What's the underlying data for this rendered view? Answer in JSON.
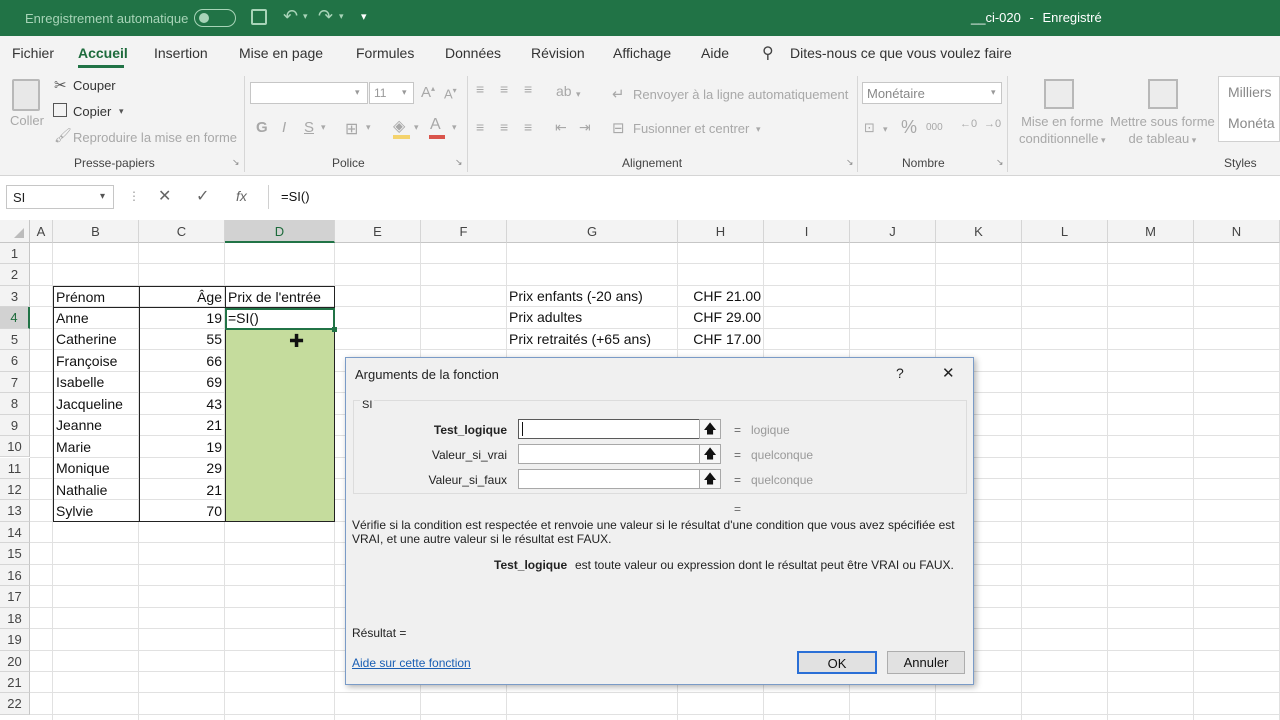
{
  "titlebar": {
    "autosave_label": "Enregistrement automatique",
    "filename": "__ci-020",
    "separator": "-",
    "status": "Enregistré",
    "save_icon": "save-icon",
    "undo_icon": "undo-icon",
    "redo_icon": "redo-icon",
    "bg_color": "#217346"
  },
  "ribbon_tabs": [
    "Fichier",
    "Accueil",
    "Insertion",
    "Mise en page",
    "Formules",
    "Données",
    "Révision",
    "Affichage",
    "Aide"
  ],
  "tell_me": "Dites-nous ce que vous voulez faire",
  "clipboard": {
    "paste": "Coller",
    "cut": "Couper",
    "copy": "Copier",
    "format_painter": "Reproduire la mise en forme",
    "group": "Presse-papiers"
  },
  "font": {
    "name_value": "",
    "size_value": "11",
    "bold": "G",
    "italic": "I",
    "underline": "S",
    "group": "Police"
  },
  "alignment": {
    "wrap_text": "Renvoyer à la ligne automatiquement",
    "merge_center": "Fusionner et centrer",
    "group": "Alignement"
  },
  "number": {
    "format_value": "Monétaire",
    "percent": "%",
    "thousands": "000",
    "group": "Nombre"
  },
  "styles": {
    "conditional": [
      "Mise en forme",
      "conditionnelle"
    ],
    "table_format": [
      "Mettre sous forme",
      "de tableau"
    ],
    "cell_style_1": "Milliers",
    "cell_style_2": "Monéta",
    "group": "Styles"
  },
  "formula_bar": {
    "name_box": "SI",
    "cancel_icon": "✕",
    "enter_icon": "✓",
    "fx": "fx",
    "formula": "=SI()"
  },
  "columns": [
    "A",
    "B",
    "C",
    "D",
    "E",
    "F",
    "G",
    "H",
    "I",
    "J",
    "K",
    "L",
    "M",
    "N"
  ],
  "rows": [
    "1",
    "2",
    "3",
    "4",
    "5",
    "6",
    "7",
    "8",
    "9",
    "10",
    "11",
    "12",
    "13",
    "14",
    "15",
    "16",
    "17",
    "18",
    "19",
    "20",
    "21",
    "22"
  ],
  "table": {
    "headers": [
      "Prénom",
      "Âge",
      "Prix de l'entrée"
    ],
    "rows": [
      {
        "name": "Anne",
        "age": "19",
        "price": "=SI()"
      },
      {
        "name": "Catherine",
        "age": "55",
        "price": ""
      },
      {
        "name": "Françoise",
        "age": "66",
        "price": ""
      },
      {
        "name": "Isabelle",
        "age": "69",
        "price": ""
      },
      {
        "name": "Jacqueline",
        "age": "43",
        "price": ""
      },
      {
        "name": "Jeanne",
        "age": "21",
        "price": ""
      },
      {
        "name": "Marie",
        "age": "19",
        "price": ""
      },
      {
        "name": "Monique",
        "age": "29",
        "price": ""
      },
      {
        "name": "Nathalie",
        "age": "21",
        "price": ""
      },
      {
        "name": "Sylvie",
        "age": "70",
        "price": ""
      }
    ],
    "fill_color": "#c5dc9d"
  },
  "prices": [
    {
      "label": "Prix enfants (-20 ans)",
      "value": "CHF 21.00"
    },
    {
      "label": "Prix adultes",
      "value": "CHF 29.00"
    },
    {
      "label": "Prix retraités (+65 ans)",
      "value": "CHF 17.00"
    }
  ],
  "dialog": {
    "title": "Arguments de la fonction",
    "help": "?",
    "close": "✕",
    "function_name": "SI",
    "args": [
      {
        "label": "Test_logique",
        "value": "",
        "result": "logique"
      },
      {
        "label": "Valeur_si_vrai",
        "value": "",
        "result": "quelconque"
      },
      {
        "label": "Valeur_si_faux",
        "value": "",
        "result": "quelconque"
      }
    ],
    "equals": "=",
    "description": "Vérifie si la condition est respectée et renvoie une valeur si le résultat d'une condition que vous avez spécifiée est VRAI, et une autre valeur si le résultat est FAUX.",
    "arg_name": "Test_logique",
    "arg_desc": "est toute valeur ou expression dont le résultat peut être VRAI ou FAUX.",
    "result_label": "Résultat =",
    "help_link": "Aide sur cette fonction",
    "ok": "OK",
    "cancel": "Annuler"
  }
}
